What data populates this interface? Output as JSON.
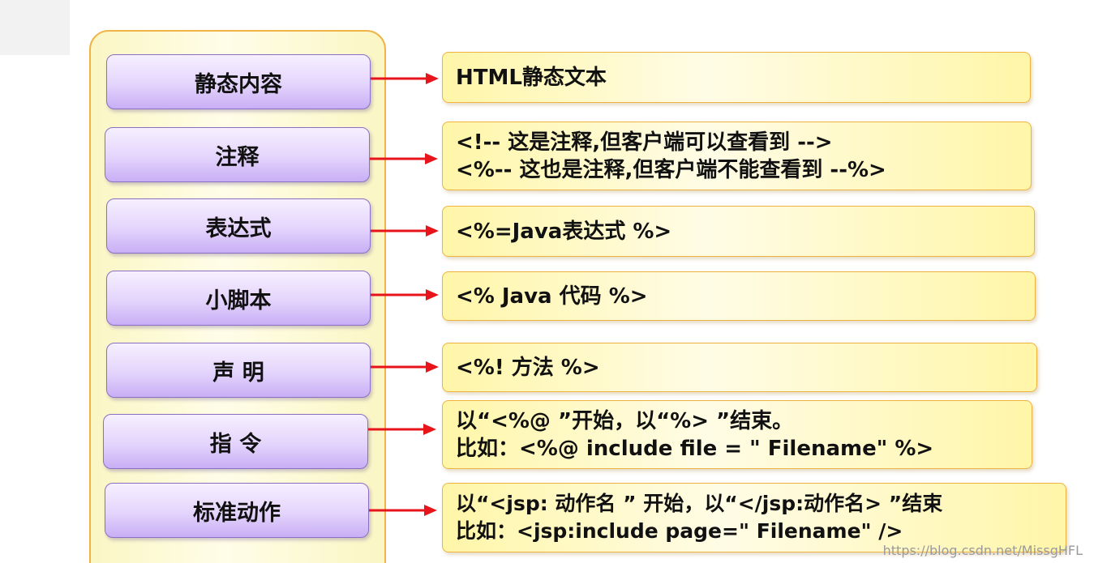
{
  "concepts": [
    {
      "label": "静态内容",
      "lines": [
        "HTML静态文本"
      ]
    },
    {
      "label": "注释",
      "lines": [
        "<!-- 这是注释,但客户端可以查看到 -->",
        "<%-- 这也是注释,但客户端不能查看到 --%>"
      ]
    },
    {
      "label": "表达式",
      "lines": [
        "<%=Java表达式 %>"
      ]
    },
    {
      "label": "小脚本",
      "lines": [
        "<% Java 代码 %>"
      ]
    },
    {
      "label": "声 明",
      "lines": [
        "<%! 方法 %>"
      ]
    },
    {
      "label": "指 令",
      "lines": [
        "以“<%@ ”开始，以“%> ”结束。",
        "比如：<%@ include file = \" Filename\" %>"
      ]
    },
    {
      "label": "标准动作",
      "lines": [
        "以“<jsp: 动作名 ” 开始，以“</jsp:动作名> ”结束",
        "比如：<jsp:include page=\" Filename\" />"
      ]
    }
  ],
  "colors": {
    "arrow": "#e8141c",
    "concept_border": "#8a6fc4",
    "desc_border": "#efb240"
  },
  "watermark": "https://blog.csdn.net/MissgHFL"
}
